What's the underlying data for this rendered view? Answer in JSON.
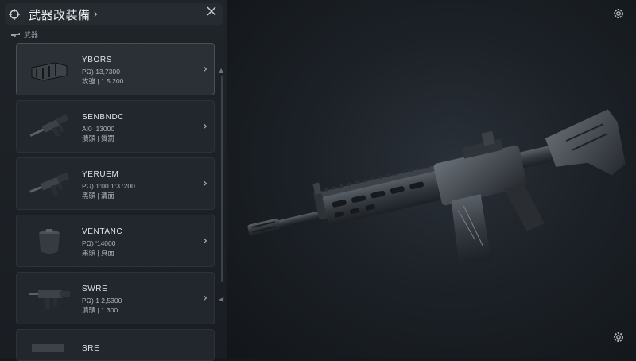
{
  "header": {
    "title": "武器改装備",
    "chevron": "›"
  },
  "section_label": "武器",
  "items": [
    {
      "name": "YBORS",
      "stat1": "PΩ) 13,7300",
      "stat2": "攻強 | 1.5.200",
      "selected": true
    },
    {
      "name": "SENBNDC",
      "stat1": "AI0 :13000",
      "stat2": "潰頭 | 質罰",
      "selected": false
    },
    {
      "name": "YERUEM",
      "stat1": "PΩ) 1:00 1:3 :200",
      "stat2": "黑頭 | 清面",
      "selected": false
    },
    {
      "name": "VENTANC",
      "stat1": "PΩ) '14000",
      "stat2": "果頭 | 頁面",
      "selected": false
    },
    {
      "name": "SWRE",
      "stat1": "PΩ) 1 2,5300",
      "stat2": "潰頭 | 1.300",
      "selected": false
    },
    {
      "name": "SRE",
      "stat1": "",
      "stat2": "",
      "selected": false
    }
  ],
  "icons": {
    "header": "crosshair-icon",
    "close": "close-icon",
    "settings": "gear-icon"
  },
  "colors": {
    "background": "#15191e",
    "panel": "#1f2429",
    "card": "#22272d",
    "accent_text": "#e1e4e7"
  }
}
